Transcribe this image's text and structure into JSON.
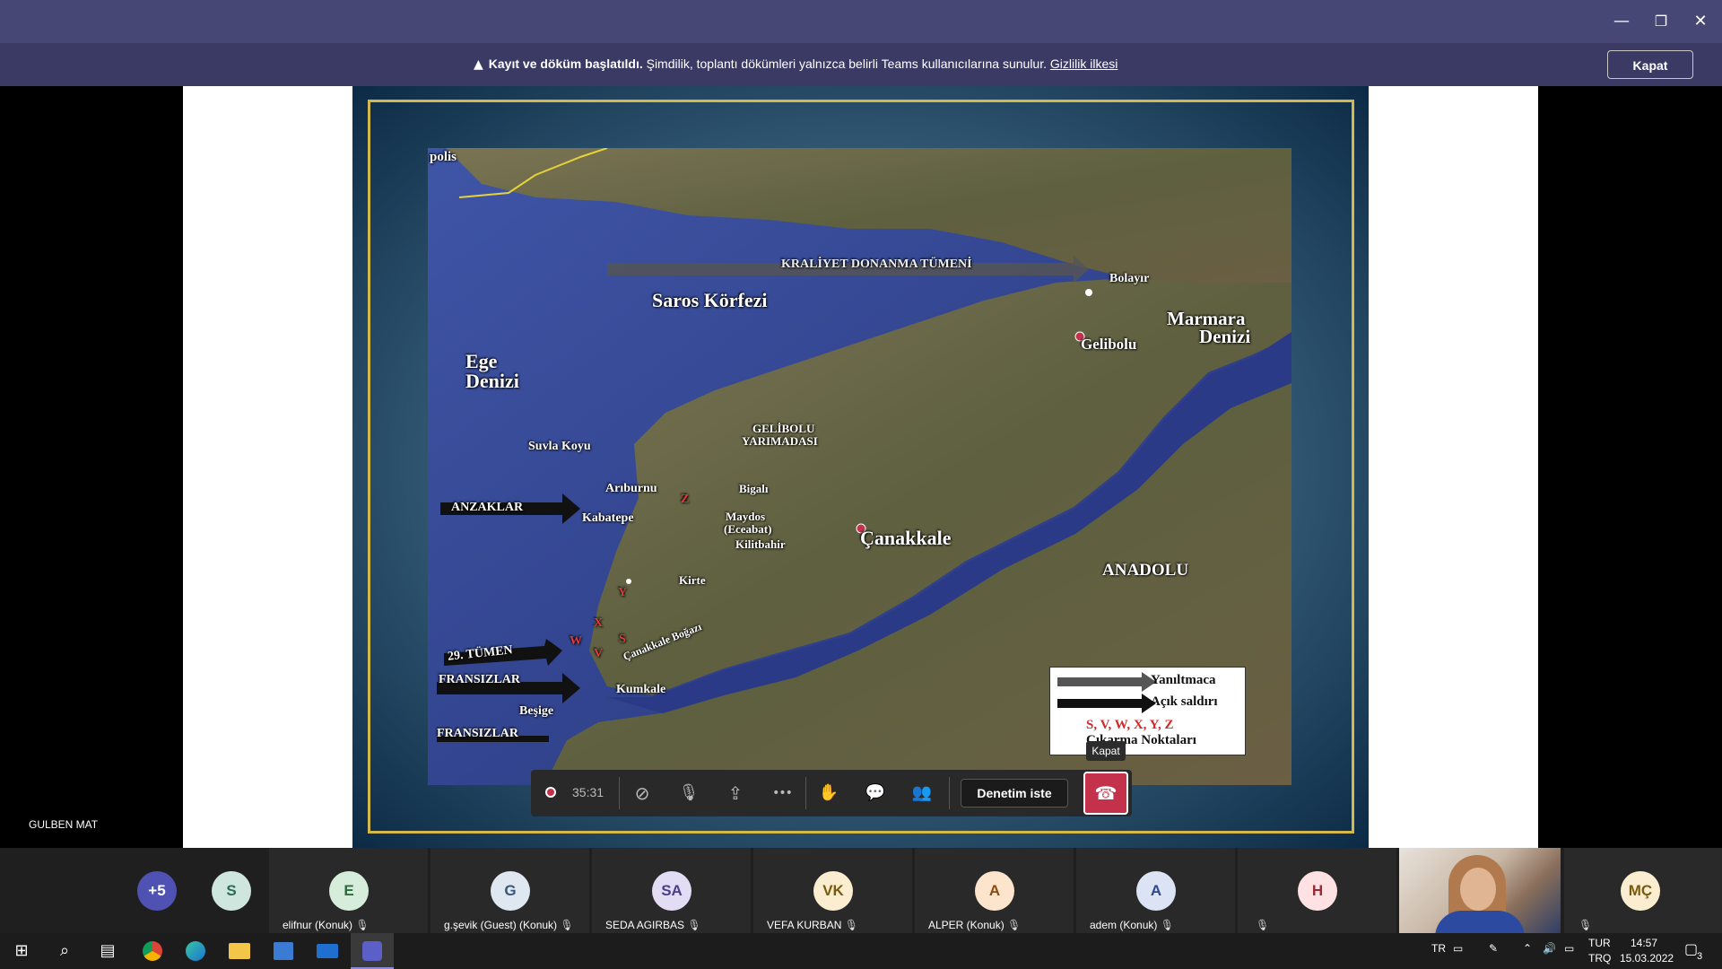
{
  "window": {
    "minimize_glyph": "—",
    "restore_glyph": "❐",
    "close_glyph": "✕"
  },
  "banner": {
    "warning_glyph": "▲",
    "bold_text": "Kayıt ve döküm başlatıldı.",
    "text": " Şimdilik, toplantı dökümleri yalnızca belirli Teams kullanıcılarına sunulur. ",
    "link": "Gizlilik ilkesi",
    "close_label": "Kapat"
  },
  "map": {
    "labels": {
      "apolis": "polis",
      "kraliyet": "KRALİYET DONANMA TÜMENİ",
      "bolayir": "Bolayır",
      "saros": "Saros Körfezi",
      "marmara1": "Marmara",
      "marmara2": "Denizi",
      "gelibolu": "Gelibolu",
      "ege1": "Ege",
      "ege2": "Denizi",
      "yarimada1": "GELİBOLU",
      "yarimada2": "YARIMADASI",
      "suvla": "Suvla Koyu",
      "ariburnu": "Arıburnu",
      "bigali": "Bigalı",
      "anzaklar": "ANZAKLAR",
      "kabatepe": "Kabatepe",
      "maydos1": "Maydos",
      "maydos2": "(Eceabat)",
      "kilitbahir": "Kilitbahir",
      "canakkale": "Çanakkale",
      "anadolu": "ANADOLU",
      "kirte": "Kirte",
      "tumen29": "29. TÜMEN",
      "bogaz": "Çanakkale Boğazı",
      "fransizlar1": "FRANSIZLAR",
      "kumkale": "Kumkale",
      "besige": "Beşige",
      "fransizlar2": "FRANSIZLAR"
    },
    "landing_letters": {
      "z": "Z",
      "y": "Y",
      "x": "X",
      "w": "W",
      "s": "S",
      "v": "V"
    },
    "legend": {
      "feint": "Yanıltmaca",
      "attack": "Açık saldırı",
      "letters": "S, V, W, X, Y, Z",
      "points": "Çıkarma Noktaları"
    }
  },
  "speaker_name": "GULBEN MAT",
  "controls": {
    "timer": "35:31",
    "camera_icon": "⊘",
    "mic_icon": "🎙",
    "share_icon": "⇪",
    "more_icon": "•••",
    "hand_icon": "✋",
    "chat_icon": "💬",
    "people_icon": "👥",
    "ask_control_label": "Denetim iste",
    "hangup_icon": "☎",
    "tooltip": "Kapat"
  },
  "participants": [
    {
      "initials": "+5",
      "name": "",
      "color": "#4f52b2",
      "fg": "#fff"
    },
    {
      "initials": "S",
      "name": "",
      "color": "#cfe6df",
      "fg": "#2b6a58"
    },
    {
      "initials": "E",
      "name": "elifnur (Konuk)",
      "color": "#d6eddc",
      "fg": "#2f6a3f"
    },
    {
      "initials": "G",
      "name": "g.şevik (Guest) (Konuk)",
      "color": "#dfe7f0",
      "fg": "#37577a"
    },
    {
      "initials": "SA",
      "name": "SEDA AGIRBAS",
      "color": "#e2dcf5",
      "fg": "#4c3e8a"
    },
    {
      "initials": "VK",
      "name": "VEFA KURBAN",
      "color": "#fbeed0",
      "fg": "#7a5a10"
    },
    {
      "initials": "A",
      "name": "ALPER (Konuk)",
      "color": "#fde4cc",
      "fg": "#8a4b14"
    },
    {
      "initials": "A",
      "name": "adem (Konuk)",
      "color": "#dbe3f5",
      "fg": "#30478a"
    },
    {
      "initials": "H",
      "name": "",
      "color": "#fde1e3",
      "fg": "#9a2a35"
    },
    {
      "initials": "MÇ",
      "name": "",
      "color": "#fbeed0",
      "fg": "#7a5a10"
    }
  ],
  "taskbar": {
    "lang": "TR",
    "kbd1": "TUR",
    "kbd2": "TRQ",
    "time": "14:57",
    "date": "15.03.2022",
    "notif": "3"
  }
}
